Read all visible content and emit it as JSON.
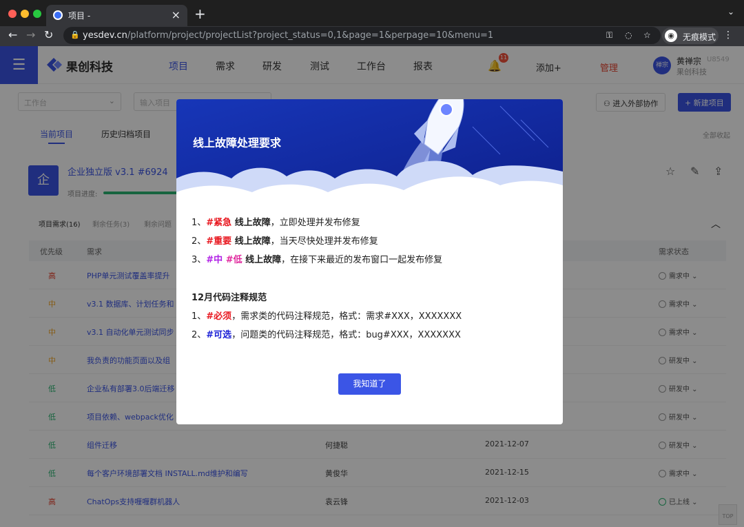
{
  "browser": {
    "tab_title": "项目 -",
    "url_host": "yesdev.cn",
    "url_path": "/platform/project/projectList?project_status=0,1&page=1&perpage=10&menu=1",
    "incognito_label": "无痕模式"
  },
  "header": {
    "logo": "果创科技",
    "nav": [
      "项目",
      "需求",
      "研发",
      "测试",
      "工作台",
      "报表"
    ],
    "notification_count": "11",
    "add": "添加+",
    "manage": "管理",
    "avatar_text": "禅宗",
    "user_name": "黄禅宗",
    "user_id": "U8549",
    "company": "果创科技"
  },
  "filters": {
    "workspace_placeholder": "工作台",
    "search_placeholder": "输入项目",
    "external_collab": "进入外部协作",
    "new_project": "+ 新建项目"
  },
  "tabs": {
    "current": "当前项目",
    "archived": "历史归档项目",
    "collapse_all": "全部收起"
  },
  "project": {
    "icon": "企",
    "title": "企业独立版 v3.1 #6924",
    "progress_label": "项目进度:"
  },
  "subtabs": [
    "项目需求(16)",
    "剩余任务(3)",
    "剩余问题"
  ],
  "table": {
    "headers": [
      "优先级",
      "需求",
      "需求状态"
    ],
    "rows": [
      {
        "priority": "高",
        "level": "high",
        "title": "PHP单元测试覆盖率提升",
        "owner": "",
        "date": "",
        "status": "需求中"
      },
      {
        "priority": "中",
        "level": "mid",
        "title": "v3.1 数据库、计划任务和",
        "owner": "",
        "date": "",
        "status": "需求中"
      },
      {
        "priority": "中",
        "level": "mid",
        "title": "v3.1 自动化单元测试同步",
        "owner": "",
        "date": "",
        "status": "需求中"
      },
      {
        "priority": "中",
        "level": "mid",
        "title": "我负责的功能页面以及组",
        "owner": "",
        "date": "",
        "status": "研发中"
      },
      {
        "priority": "低",
        "level": "low",
        "title": "企业私有部署3.0后端迁移",
        "owner": "",
        "date": "",
        "status": "研发中"
      },
      {
        "priority": "低",
        "level": "low",
        "title": "项目依赖、webpack优化",
        "owner": "",
        "date": "",
        "status": "研发中"
      },
      {
        "priority": "低",
        "level": "low",
        "title": "组件迁移",
        "owner": "何捷聪",
        "date": "2021-12-07",
        "status": "研发中"
      },
      {
        "priority": "低",
        "level": "low",
        "title": "每个客户环境部署文档 INSTALL.md维护和编写",
        "owner": "黄俊华",
        "date": "2021-12-15",
        "status": "需求中"
      },
      {
        "priority": "高",
        "level": "high",
        "title": "ChatOps支持喱喱群机器人",
        "owner": "袁云锋",
        "date": "2021-12-03",
        "status": "已上线"
      }
    ]
  },
  "top_button": "TOP",
  "modal": {
    "title": "线上故障处理要求",
    "line1": {
      "num": "1、",
      "tag": "#紧急",
      "strong": " 线上故障",
      "rest": "，立即处理并发布修复"
    },
    "line2": {
      "num": "2、",
      "tag": "#重要",
      "strong": " 线上故障",
      "rest": "，当天尽快处理并发布修复"
    },
    "line3": {
      "num": "3、",
      "tag1": "#中",
      "tag2": " #低",
      "strong": " 线上故障",
      "rest": "，在接下来最近的发布窗口一起发布修复"
    },
    "section2_title": "12月代码注释规范",
    "line4": {
      "num": "1、",
      "tag": "#必须",
      "rest": "，需求类的代码注释规范，格式：需求#XXX，XXXXXXX"
    },
    "line5": {
      "num": "2、",
      "tag": "#可选",
      "rest": "，问题类的代码注释规范，格式：bug#XXX，XXXXXXX"
    },
    "ok_button": "我知道了"
  }
}
